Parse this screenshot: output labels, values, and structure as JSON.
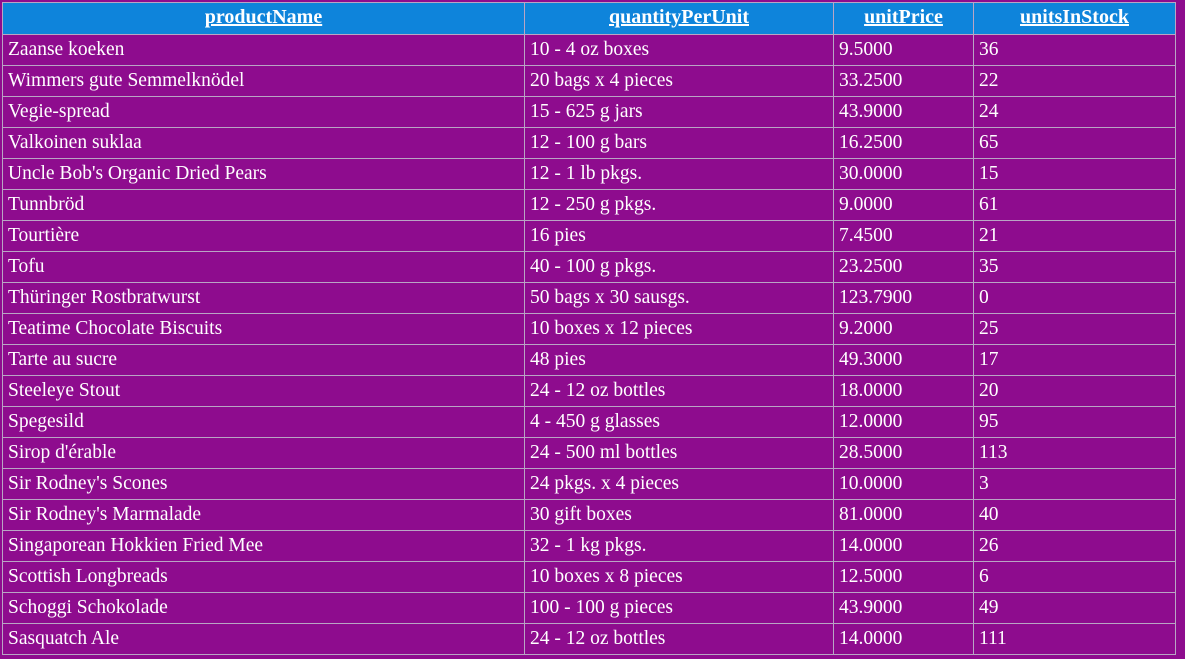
{
  "table": {
    "columns": [
      {
        "key": "productName",
        "label": "productName"
      },
      {
        "key": "quantityPerUnit",
        "label": "quantityPerUnit"
      },
      {
        "key": "unitPrice",
        "label": "unitPrice"
      },
      {
        "key": "unitsInStock",
        "label": "unitsInStock"
      }
    ],
    "colors": {
      "header_background": "#0e84db",
      "row_background": "#8e0c8e",
      "page_background": "#8e0c8e",
      "text": "#ffffff",
      "grid_line": "#b9a5c4"
    },
    "rows": [
      {
        "productName": "Zaanse koeken",
        "quantityPerUnit": "10 - 4 oz boxes",
        "unitPrice": "9.5000",
        "unitsInStock": "36"
      },
      {
        "productName": "Wimmers gute Semmelknödel",
        "quantityPerUnit": "20 bags x 4 pieces",
        "unitPrice": "33.2500",
        "unitsInStock": "22"
      },
      {
        "productName": "Vegie-spread",
        "quantityPerUnit": "15 - 625 g jars",
        "unitPrice": "43.9000",
        "unitsInStock": "24"
      },
      {
        "productName": "Valkoinen suklaa",
        "quantityPerUnit": "12 - 100 g bars",
        "unitPrice": "16.2500",
        "unitsInStock": "65"
      },
      {
        "productName": "Uncle Bob's Organic Dried Pears",
        "quantityPerUnit": "12 - 1 lb pkgs.",
        "unitPrice": "30.0000",
        "unitsInStock": "15"
      },
      {
        "productName": "Tunnbröd",
        "quantityPerUnit": "12 - 250 g pkgs.",
        "unitPrice": "9.0000",
        "unitsInStock": "61"
      },
      {
        "productName": "Tourtière",
        "quantityPerUnit": "16 pies",
        "unitPrice": "7.4500",
        "unitsInStock": "21"
      },
      {
        "productName": "Tofu",
        "quantityPerUnit": "40 - 100 g pkgs.",
        "unitPrice": "23.2500",
        "unitsInStock": "35"
      },
      {
        "productName": "Thüringer Rostbratwurst",
        "quantityPerUnit": "50 bags x 30 sausgs.",
        "unitPrice": "123.7900",
        "unitsInStock": "0"
      },
      {
        "productName": "Teatime Chocolate Biscuits",
        "quantityPerUnit": "10 boxes x 12 pieces",
        "unitPrice": "9.2000",
        "unitsInStock": "25"
      },
      {
        "productName": "Tarte au sucre",
        "quantityPerUnit": "48 pies",
        "unitPrice": "49.3000",
        "unitsInStock": "17"
      },
      {
        "productName": "Steeleye Stout",
        "quantityPerUnit": "24 - 12 oz bottles",
        "unitPrice": "18.0000",
        "unitsInStock": "20"
      },
      {
        "productName": "Spegesild",
        "quantityPerUnit": "4 - 450 g glasses",
        "unitPrice": "12.0000",
        "unitsInStock": "95"
      },
      {
        "productName": "Sirop d'érable",
        "quantityPerUnit": "24 - 500 ml bottles",
        "unitPrice": "28.5000",
        "unitsInStock": "113"
      },
      {
        "productName": "Sir Rodney's Scones",
        "quantityPerUnit": "24 pkgs. x 4 pieces",
        "unitPrice": "10.0000",
        "unitsInStock": "3"
      },
      {
        "productName": "Sir Rodney's Marmalade",
        "quantityPerUnit": "30 gift boxes",
        "unitPrice": "81.0000",
        "unitsInStock": "40"
      },
      {
        "productName": "Singaporean Hokkien Fried Mee",
        "quantityPerUnit": "32 - 1 kg pkgs.",
        "unitPrice": "14.0000",
        "unitsInStock": "26"
      },
      {
        "productName": "Scottish Longbreads",
        "quantityPerUnit": "10 boxes x 8 pieces",
        "unitPrice": "12.5000",
        "unitsInStock": "6"
      },
      {
        "productName": "Schoggi Schokolade",
        "quantityPerUnit": "100 - 100 g pieces",
        "unitPrice": "43.9000",
        "unitsInStock": "49"
      },
      {
        "productName": "Sasquatch Ale",
        "quantityPerUnit": "24 - 12 oz bottles",
        "unitPrice": "14.0000",
        "unitsInStock": "111"
      }
    ]
  }
}
